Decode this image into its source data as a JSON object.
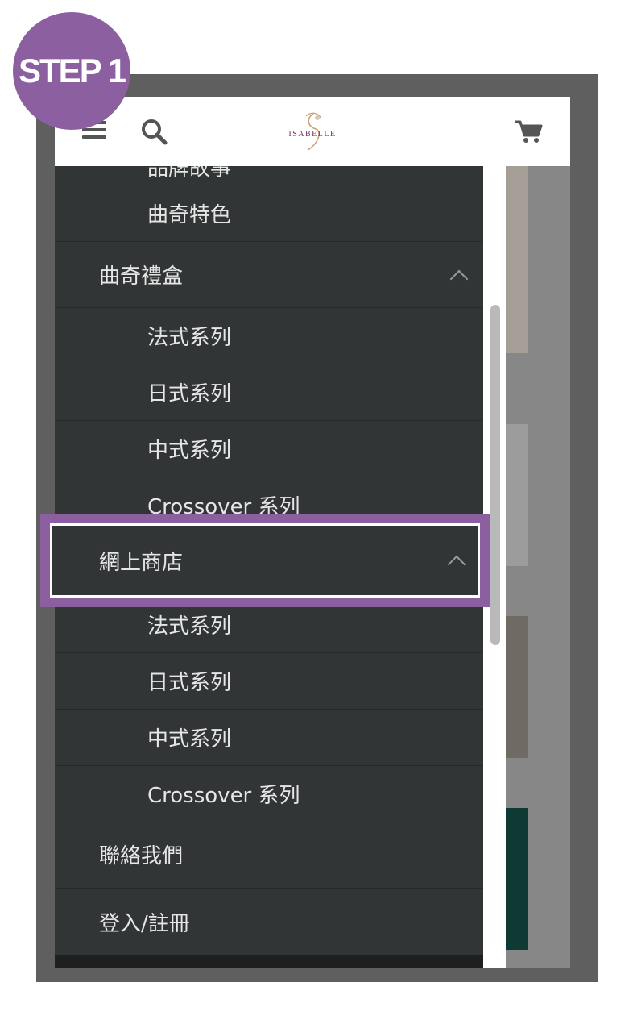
{
  "badge": {
    "label": "STEP 1"
  },
  "header": {
    "logo_text": "ISABELLE",
    "icons": [
      "hamburger-icon",
      "search-icon",
      "cart-icon"
    ]
  },
  "menu": {
    "partial_top": "品牌故事",
    "items": [
      {
        "label": "曲奇特色",
        "level": "sub"
      },
      {
        "label": "曲奇禮盒",
        "level": "top",
        "expanded": true
      },
      {
        "label": "法式系列",
        "level": "sub"
      },
      {
        "label": "日式系列",
        "level": "sub"
      },
      {
        "label": "中式系列",
        "level": "sub"
      },
      {
        "label": "Crossover 系列",
        "level": "sub"
      },
      {
        "label": "網上商店",
        "level": "top",
        "expanded": true,
        "highlighted": true
      },
      {
        "label": "法式系列",
        "level": "sub"
      },
      {
        "label": "日式系列",
        "level": "sub"
      },
      {
        "label": "中式系列",
        "level": "sub"
      },
      {
        "label": "Crossover 系列",
        "level": "sub"
      },
      {
        "label": "聯絡我們",
        "level": "top"
      },
      {
        "label": "登入/註冊",
        "level": "top"
      }
    ]
  },
  "colors": {
    "accent": "#8b5fa0",
    "drawer_bg": "#323536",
    "menu_text": "#e6e6e6"
  }
}
